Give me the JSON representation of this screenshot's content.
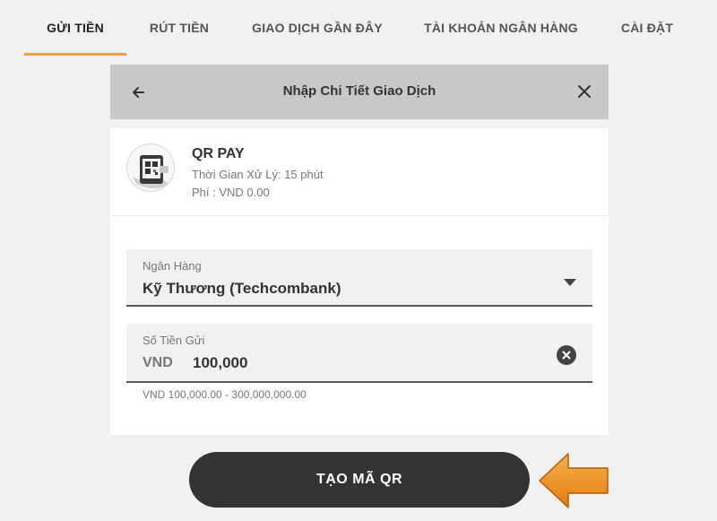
{
  "tabs": {
    "deposit": "GỬI TIỀN",
    "withdraw": "RÚT TIỀN",
    "recent": "GIAO DỊCH GẦN ĐÂY",
    "bank_account": "TÀI KHOẢN NGÂN HÀNG",
    "settings": "CÀI ĐẶT",
    "active": "deposit",
    "accent_color": "#f5a03a"
  },
  "dialog": {
    "title": "Nhập Chi Tiết Giao Dịch",
    "back_icon": "arrow-left-icon",
    "close_icon": "close-icon"
  },
  "method": {
    "name": "QR PAY",
    "processing_time": "Thời Gian Xử Lý: 15 phút",
    "fee": "Phí : VND 0.00",
    "icon": "qr-phone-icon"
  },
  "form": {
    "bank_label": "Ngân Hàng",
    "bank_value": "Kỹ Thương (Techcombank)",
    "amount_label": "Số Tiền Gửi",
    "currency": "VND",
    "amount_value": "100,000",
    "amount_range": "VND 100,000.00 - 300,000,000.00"
  },
  "submit": {
    "label": "TẠO MÃ QR",
    "color": "#333333"
  },
  "annotation": {
    "arrow_color": "#f39a1e"
  }
}
